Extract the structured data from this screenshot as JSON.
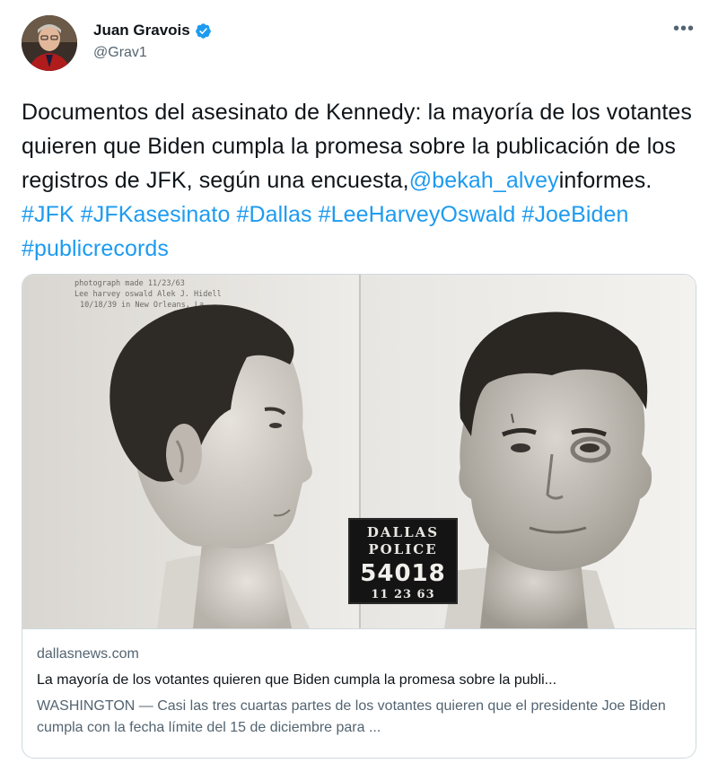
{
  "author": {
    "name": "Juan Gravois",
    "handle": "@Grav1",
    "verified_icon": "verified-badge-icon",
    "avatar_icon": "profile-photo"
  },
  "menu_icon": "more-options-icon",
  "tweet": {
    "text_before_mention": "Documentos del asesinato de Kennedy: la mayoría de los votantes quieren que Biden cumpla la promesa sobre la publicación de los registros de JFK, según una encuesta,",
    "mention": "@bekah_alvey",
    "text_after_mention": "informes. ",
    "hashtags": [
      "#JFK",
      "#JFKasesinato",
      "#Dallas",
      "#LeeHarveyOswald",
      "#JoeBiden",
      "#publicrecords"
    ]
  },
  "card": {
    "domain": "dallasnews.com",
    "title": "La mayoría de los votantes quieren que Biden cumpla la promesa sobre la publi...",
    "description": "WASHINGTON — Casi las tres cuartas partes de los votantes quieren que el presidente Joe Biden cumpla con la fecha límite del 15 de diciembre para ...",
    "image": {
      "placard_line1": "DALLAS",
      "placard_line2": "POLICE",
      "placard_number": "54018",
      "placard_date": "11 23 63",
      "typed_line1": "photograph made 11/23/63",
      "typed_line2": "Lee harvey oswald  Alek J. Hidell",
      "typed_line3": "10/18/39 in New Orleans, La."
    }
  },
  "colors": {
    "link": "#1d9bf0",
    "text": "#0f1419",
    "secondary": "#536471",
    "border": "#cfd9de"
  }
}
